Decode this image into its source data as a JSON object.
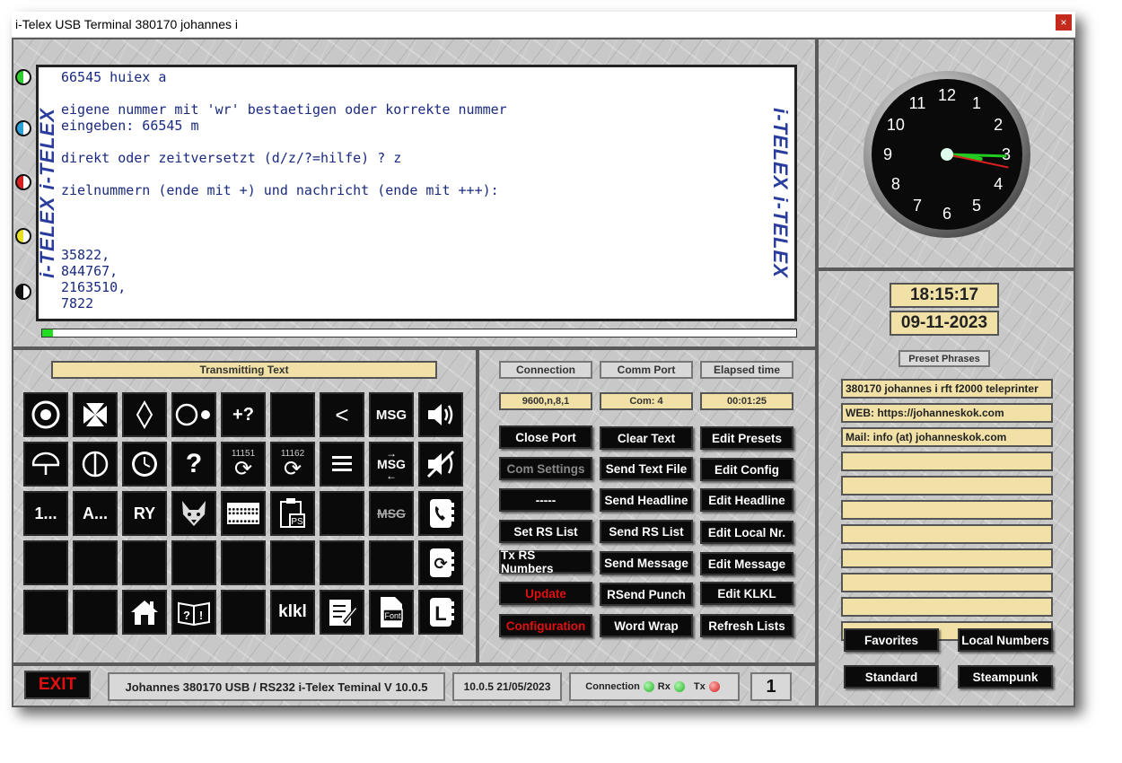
{
  "window": {
    "title": "i-Telex USB Terminal  380170 johannes i",
    "close_glyph": "×"
  },
  "terminal": {
    "lines": [
      "66545 huiex a",
      "",
      "eigene nummer mit 'wr' bestaetigen oder korrekte nummer",
      "eingeben: 66545 m",
      "",
      "direkt oder zeitversetzt (d/z/?=hilfe) ? z",
      "",
      "zielnummern (ende mit +) und nachricht (ende mit +++):",
      "",
      "",
      "",
      "35822,",
      "844767,",
      "2163510,",
      "7822"
    ],
    "band_text": "i-TELEX i-TELEX"
  },
  "clock": {
    "time": "18:15:17",
    "date": "09-11-2023",
    "hour": 3,
    "minute": 15,
    "second": 17
  },
  "transmit_label": "Transmitting Text",
  "status_labels": {
    "connection": "Connection",
    "comm_port": "Comm Port",
    "elapsed": "Elapsed time"
  },
  "status_values": {
    "connection": "9600,n,8,1",
    "comm_port": "Com:  4",
    "elapsed": "00:01:25"
  },
  "buttons": [
    [
      "Close Port",
      "Clear Text",
      "Edit Presets"
    ],
    [
      "Com Settings",
      "Send Text File",
      "Edit Config"
    ],
    [
      "-----",
      "Send Headline",
      "Edit Headline"
    ],
    [
      "Set RS List",
      "Send RS List",
      "Edit Local Nr."
    ],
    [
      "Tx RS Numbers",
      "Send Message",
      "Edit Message"
    ],
    [
      "Update",
      "RSend Punch",
      "Edit KLKL"
    ],
    [
      "Configuration",
      "Word Wrap",
      "Refresh Lists"
    ]
  ],
  "grid_labels": {
    "plus_q": "+?",
    "lt": "<",
    "msg": "MSG",
    "q": "?",
    "num1": "11151",
    "num2": "11162",
    "dots_num": "1...",
    "dots_alpha": "A...",
    "ry": "RY",
    "klkl": "klkl",
    "ps": "PS",
    "font": "Font",
    "l": "L"
  },
  "preset_title": "Preset Phrases",
  "phrases": [
    "380170 johannes i rft f2000 teleprinter",
    "WEB: https://johanneskok.com",
    "Mail: info (at) johanneskok.com",
    "",
    "",
    "",
    "",
    "",
    "",
    "",
    ""
  ],
  "right_buttons": [
    "Favorites",
    "Local Numbers",
    "Standard",
    "Steampunk"
  ],
  "statusbar": {
    "exit": "EXIT",
    "info": "Johannes 380170 USB / RS232 i-Telex Teminal V 10.0.5",
    "version": "10.0.5  21/05/2023",
    "conn": "Connection",
    "rx": "Rx",
    "tx": "Tx",
    "count": "1"
  },
  "colors": {
    "lcd": "#f1e1a7",
    "term_text": "#1a2a80",
    "danger": "#e01010",
    "led_green": "#2ecc2e",
    "led_red": "#e02020"
  }
}
